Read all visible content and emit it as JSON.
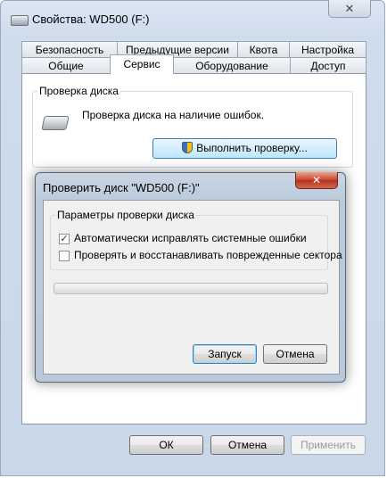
{
  "window": {
    "title": "Свойства: WD500 (F:)",
    "close_symbol": "✕"
  },
  "tabs": {
    "row1": [
      "Безопасность",
      "Предыдущие версии",
      "Квота",
      "Настройка"
    ],
    "row2": [
      "Общие",
      "Сервис",
      "Оборудование",
      "Доступ"
    ],
    "active": "Сервис"
  },
  "service": {
    "group_label": "Проверка диска",
    "description": "Проверка диска на наличие ошибок.",
    "run_check_label": "Выполнить проверку..."
  },
  "dialog": {
    "title": "Проверить диск \"WD500 (F:)\"",
    "close_symbol": "✕",
    "group_label": "Параметры проверки диска",
    "options": [
      {
        "label": "Автоматически исправлять системные ошибки",
        "checked": true
      },
      {
        "label": "Проверять и восстанавливать поврежденные сектора",
        "checked": false
      }
    ],
    "progress": 0,
    "start_label": "Запуск",
    "cancel_label": "Отмена"
  },
  "footer": {
    "ok_label": "ОК",
    "cancel_label": "Отмена",
    "apply_label": "Применить"
  },
  "icons": {
    "title_icon": "drive-icon",
    "disk_icon": "hard-drive-icon",
    "uac_icon": "shield-icon"
  },
  "colors": {
    "close_red": "#c7432c",
    "accent_blue": "#3c7fb1"
  }
}
